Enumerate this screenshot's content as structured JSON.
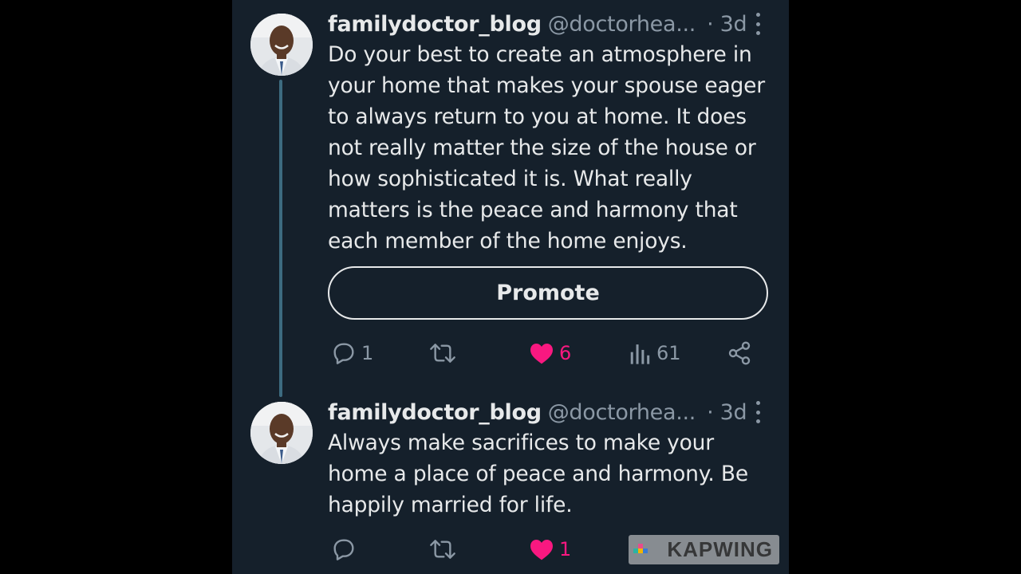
{
  "tweets": [
    {
      "display_name": "familydoctor_blog",
      "handle": "@doctorhea...",
      "time": "· 3d",
      "text": "Do your best to create an atmosphere in your home that makes your spouse eager to always return to you at home. It does not really matter the size of the house or how sophisticated it is. What really matters is the peace and harmony that each member of the home enjoys.",
      "promote_label": "Promote",
      "replies": "1",
      "likes": "6",
      "views": "61"
    },
    {
      "display_name": "familydoctor_blog",
      "handle": "@doctorhea...",
      "time": "· 3d",
      "text": "Always make sacrifices to make your home a place of peace and harmony. Be happily married for life.",
      "likes": "1"
    }
  ],
  "watermark": {
    "text": "KAPWING"
  },
  "icons": [
    "avatar",
    "more-icon",
    "reply-icon",
    "retweet-icon",
    "heart-icon",
    "views-icon",
    "share-icon"
  ],
  "colors": {
    "background": "#15202b",
    "text": "#e7e9ea",
    "muted": "#8b98a5",
    "like": "#f91880",
    "thread_line": "#3d6b80"
  }
}
